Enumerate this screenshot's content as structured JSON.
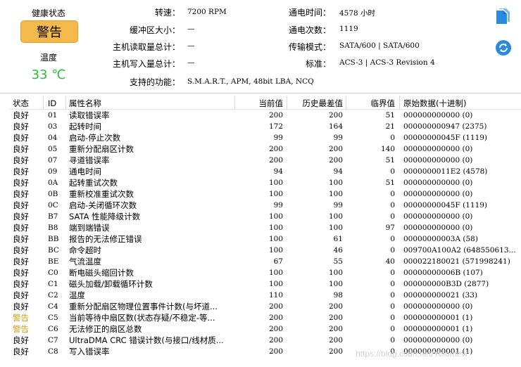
{
  "summary": {
    "health_label": "健康状态",
    "health_value": "警告",
    "temp_label": "温度",
    "temp_value": "33 ℃",
    "rpm_label": "转速：",
    "rpm_value": "7200 RPM",
    "buffer_label": "缓冲区大小：",
    "buffer_value": "—",
    "host_reads_label": "主机读取量总计：",
    "host_reads_value": "—",
    "host_writes_label": "主机写入量总计：",
    "host_writes_value": "—",
    "power_on_hours_label": "通电时间：",
    "power_on_hours_value": "4578 小时",
    "power_on_count_label": "通电次数：",
    "power_on_count_value": "1119",
    "transfer_label": "传输模式：",
    "transfer_value": "SATA/600 | SATA/600",
    "standard_label": "标准：",
    "standard_value": "ACS-3 | ACS-3 Revision 4",
    "features_label": "支持的功能：",
    "features_value": "S.M.A.R.T., APM, 48bit LBA, NCQ"
  },
  "toolbar": {
    "copy_icon": "copy-icon",
    "refresh_icon": "refresh-icon",
    "accent": "#1e88e5"
  },
  "colors": {
    "warning_badge": "#f5b84a",
    "temperature": "#2dbb3b",
    "warning_text": "#d4a017"
  },
  "table": {
    "headers": {
      "status": "状态",
      "id": "ID",
      "name": "属性名称",
      "current": "当前值",
      "worst": "历史最差值",
      "threshold": "临界值",
      "raw": "原始数据(十进制)"
    },
    "rows": [
      {
        "status": "良好",
        "id": "01",
        "name": "读取错误率",
        "current": "200",
        "worst": "200",
        "threshold": "51",
        "raw": "000000000000 (0)"
      },
      {
        "status": "良好",
        "id": "03",
        "name": "起转时间",
        "current": "172",
        "worst": "164",
        "threshold": "21",
        "raw": "000000000947 (2375)"
      },
      {
        "status": "良好",
        "id": "04",
        "name": "启动-停止次数",
        "current": "99",
        "worst": "99",
        "threshold": "0",
        "raw": "00000000045F (1119)"
      },
      {
        "status": "良好",
        "id": "05",
        "name": "重新分配扇区计数",
        "current": "200",
        "worst": "200",
        "threshold": "140",
        "raw": "000000000000 (0)"
      },
      {
        "status": "良好",
        "id": "07",
        "name": "寻道错误率",
        "current": "200",
        "worst": "200",
        "threshold": "51",
        "raw": "000000000000 (0)"
      },
      {
        "status": "良好",
        "id": "09",
        "name": "通电时间",
        "current": "94",
        "worst": "94",
        "threshold": "0",
        "raw": "0000000011E2 (4578)"
      },
      {
        "status": "良好",
        "id": "0A",
        "name": "起转重试次数",
        "current": "100",
        "worst": "100",
        "threshold": "51",
        "raw": "000000000000 (0)"
      },
      {
        "status": "良好",
        "id": "0B",
        "name": "重新校准重试次数",
        "current": "100",
        "worst": "100",
        "threshold": "0",
        "raw": "000000000000 (0)"
      },
      {
        "status": "良好",
        "id": "0C",
        "name": "启动-关闭循环次数",
        "current": "99",
        "worst": "99",
        "threshold": "0",
        "raw": "00000000045F (1119)"
      },
      {
        "status": "良好",
        "id": "B7",
        "name": "SATA 性能降级计数",
        "current": "100",
        "worst": "100",
        "threshold": "0",
        "raw": "000000000000 (0)"
      },
      {
        "status": "良好",
        "id": "B8",
        "name": "端到端错误",
        "current": "100",
        "worst": "100",
        "threshold": "97",
        "raw": "000000000000 (0)"
      },
      {
        "status": "良好",
        "id": "BB",
        "name": "报告的无法修正错误",
        "current": "100",
        "worst": "61",
        "threshold": "0",
        "raw": "00000000003A (58)"
      },
      {
        "status": "良好",
        "id": "BC",
        "name": "命令超时",
        "current": "100",
        "worst": "46",
        "threshold": "0",
        "raw": "009700A100A2 (648550613..."
      },
      {
        "status": "良好",
        "id": "BE",
        "name": "气流温度",
        "current": "67",
        "worst": "55",
        "threshold": "40",
        "raw": "000022180021 (571998241)"
      },
      {
        "status": "良好",
        "id": "C0",
        "name": "断电磁头缩回计数",
        "current": "100",
        "worst": "100",
        "threshold": "0",
        "raw": "00000000006B (107)"
      },
      {
        "status": "良好",
        "id": "C1",
        "name": "磁头加载/卸载循环计数",
        "current": "100",
        "worst": "100",
        "threshold": "0",
        "raw": "000000000B3D (2877)"
      },
      {
        "status": "良好",
        "id": "C2",
        "name": "温度",
        "current": "110",
        "worst": "98",
        "threshold": "0",
        "raw": "000000000021 (33)"
      },
      {
        "status": "良好",
        "id": "C4",
        "name": "重新分配扇区物理位置事件计数(与坏道...",
        "current": "200",
        "worst": "200",
        "threshold": "0",
        "raw": "000000000000 (0)"
      },
      {
        "status": "警告",
        "id": "C5",
        "name": "当前等待中扇区数(状态存疑/不稳定-等...",
        "current": "200",
        "worst": "200",
        "threshold": "0",
        "raw": "000000000001 (1)"
      },
      {
        "status": "警告",
        "id": "C6",
        "name": "无法修正的扇区总数",
        "current": "200",
        "worst": "200",
        "threshold": "0",
        "raw": "000000000001 (1)"
      },
      {
        "status": "良好",
        "id": "C7",
        "name": "UltraDMA CRC 错误计数(与接口/线材质...",
        "current": "200",
        "worst": "200",
        "threshold": "0",
        "raw": "000000000000 (0)"
      },
      {
        "status": "良好",
        "id": "C8",
        "name": "写入错误率",
        "current": "200",
        "worst": "200",
        "threshold": "0",
        "raw": "000000000001 (1)"
      }
    ]
  },
  "watermark": "https://blog.csdn.net/Yolomew"
}
